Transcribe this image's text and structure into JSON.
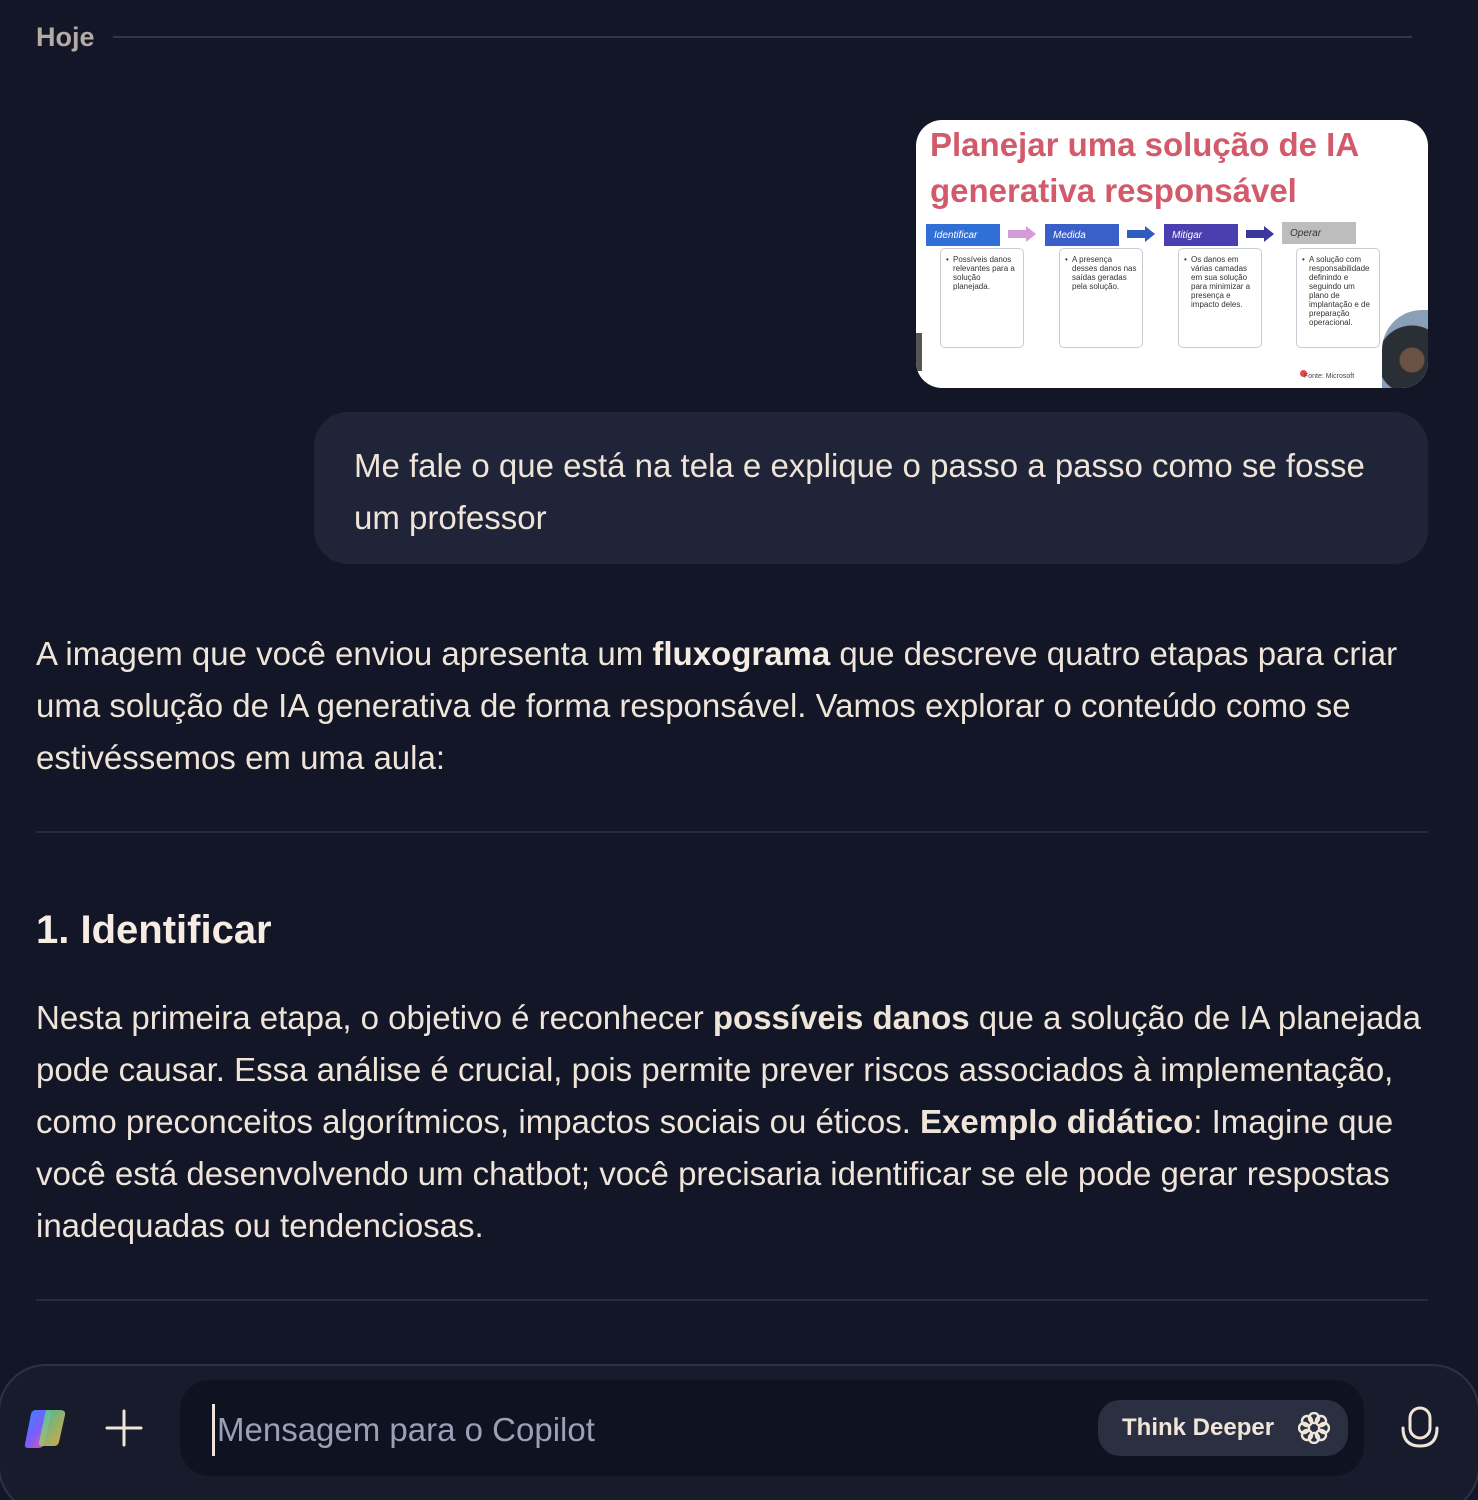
{
  "divider": {
    "label": "Hoje"
  },
  "image": {
    "title": "Planejar uma solução de IA generativa responsável",
    "steps": [
      {
        "label": "Identificar",
        "text": "Possíveis danos relevantes para a solução planejada.",
        "color": "#2f6fd6"
      },
      {
        "label": "Medida",
        "text": "A presença desses danos nas saídas geradas pela solução.",
        "color": "#3b5fc8"
      },
      {
        "label": "Mitigar",
        "text": "Os danos em várias camadas em sua solução para minimizar a presença e impacto deles.",
        "color": "#4a3fae"
      },
      {
        "label": "Operar",
        "text": "A solução com responsabilidade definindo e seguindo um plano de implantação e de preparação operacional.",
        "color": "#bdbdbd"
      }
    ],
    "arrow_colors": [
      "#d49bd8",
      "#2f5cc0",
      "#3a3898"
    ],
    "source": "Fonte: Microsoft"
  },
  "user_message": "Me fale o que está na tela e explique o passo a passo como se fosse um professor",
  "response": {
    "intro_before": "A imagem que você enviou apresenta um ",
    "intro_bold": "fluxograma",
    "intro_after": " que descreve quatro etapas para criar uma solução de IA generativa de forma responsável. Vamos explorar o conteúdo como se estivéssemos em uma aula:",
    "section_heading": "1. Identificar",
    "body_1": "Nesta primeira etapa, o objetivo é reconhecer ",
    "body_bold_1": "possíveis danos",
    "body_2": " que a solução de IA planejada pode causar. Essa análise é crucial, pois permite prever riscos associados à implementação, como preconceitos algorítmicos, impactos sociais ou éticos. ",
    "body_bold_2": "Exemplo didático",
    "body_3": ": Imagine que você está desenvolvendo um chatbot; você precisaria identificar se ele pode gerar respostas inadequadas ou tendenciosas."
  },
  "composer": {
    "placeholder": "Mensagem para o Copilot",
    "think_label": "Think Deeper",
    "icons": [
      "copilot-logo",
      "plus-icon",
      "think-deeper-icon",
      "microphone-icon"
    ]
  },
  "colors": {
    "background": "#121626",
    "bubble": "#1f2438",
    "text": "#efe4d8",
    "slide_title": "#d25a6b"
  }
}
